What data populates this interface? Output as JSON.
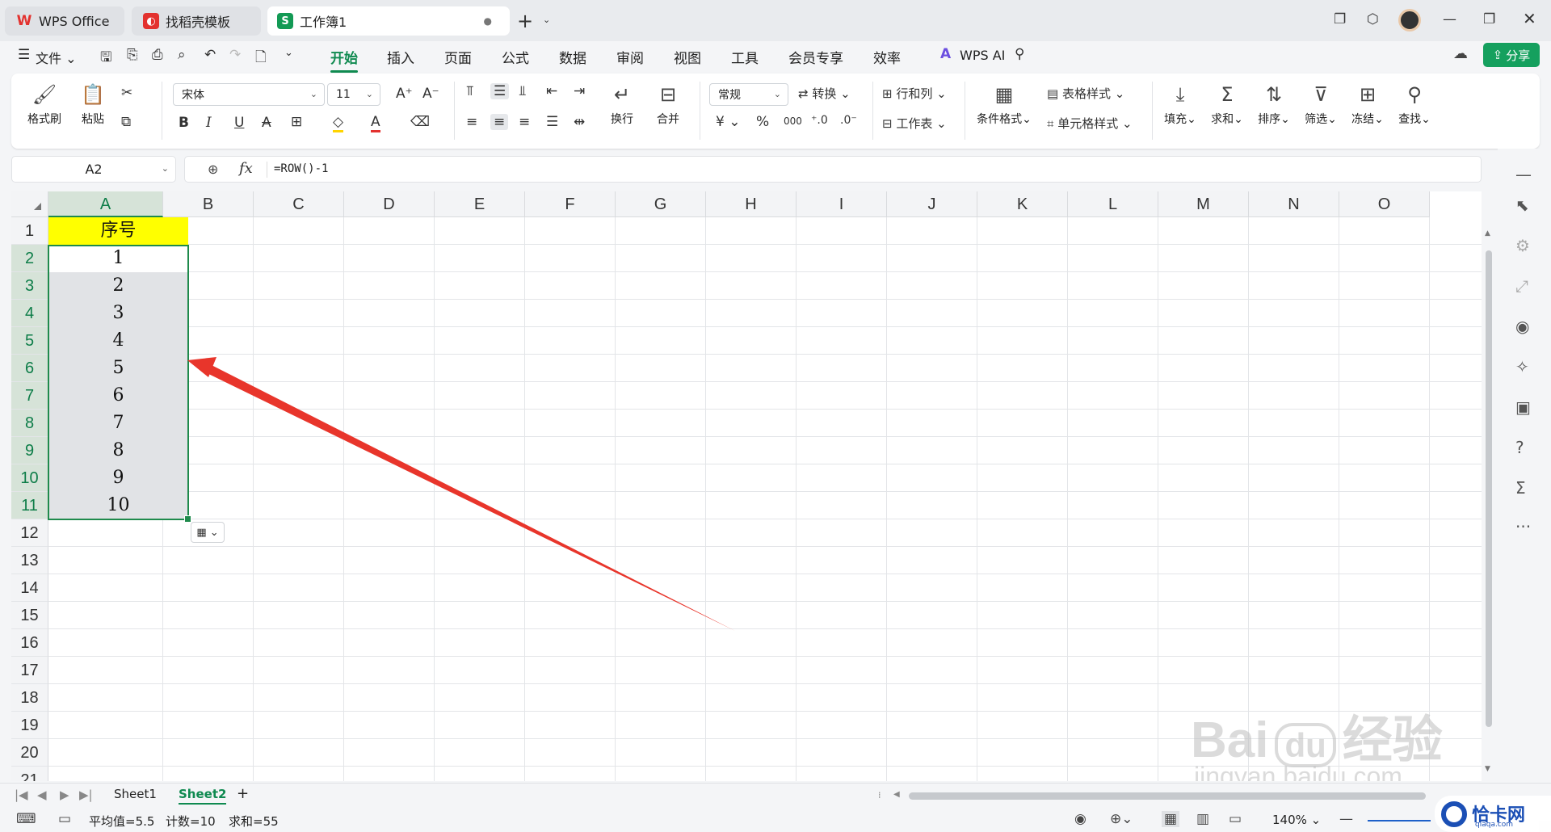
{
  "tabs": [
    {
      "label": "WPS Office"
    },
    {
      "label": "找稻壳模板"
    },
    {
      "label": "工作簿1"
    }
  ],
  "menubar": {
    "file": "文件",
    "items": [
      "开始",
      "插入",
      "页面",
      "公式",
      "数据",
      "审阅",
      "视图",
      "工具",
      "会员专享",
      "效率"
    ],
    "wps_ai": "WPS AI",
    "share": "分享"
  },
  "ribbon": {
    "format_painter": "格式刷",
    "paste": "粘贴",
    "font_name": "宋体",
    "font_size": "11",
    "wrap": "换行",
    "merge": "合并",
    "number_format": "常规",
    "convert": "转换",
    "rows_cols": "行和列",
    "worksheet": "工作表",
    "cond_format": "条件格式",
    "table_style": "表格样式",
    "cell_style": "单元格样式",
    "fill": "填充",
    "sum": "求和",
    "sort": "排序",
    "filter": "筛选",
    "freeze": "冻结",
    "find": "查找",
    "currency_symbol": "¥",
    "percent_symbol": "%",
    "thousands_symbol": "000"
  },
  "formula": {
    "name_box": "A2",
    "fx": "fx",
    "value": "=ROW()-1"
  },
  "grid": {
    "columns": [
      "A",
      "B",
      "C",
      "D",
      "E",
      "F",
      "G",
      "H",
      "I",
      "J",
      "K",
      "L",
      "M",
      "N",
      "O"
    ],
    "rows": [
      "1",
      "2",
      "3",
      "4",
      "5",
      "6",
      "7",
      "8",
      "9",
      "10",
      "11",
      "12",
      "13",
      "14",
      "15",
      "16",
      "17",
      "18",
      "19",
      "20",
      "21"
    ],
    "cells_a": [
      "序号",
      "1",
      "2",
      "3",
      "4",
      "5",
      "6",
      "7",
      "8",
      "9",
      "10"
    ],
    "header_fill": "#ffff00",
    "selection_color": "#1f8a4c",
    "arrow_color": "#e8352b"
  },
  "sheets": [
    "Sheet1",
    "Sheet2"
  ],
  "active_sheet": "Sheet2",
  "status": {
    "average": "平均值=5.5",
    "count": "计数=10",
    "sum": "求和=55",
    "zoom": "140%"
  },
  "watermarks": {
    "baidu": "Bai",
    "baidu_du": "du",
    "baidu_cn": "经验",
    "baidu_url": "jingyan.baidu.com",
    "site": "恰卡网",
    "site_url": "qiaqa.com"
  }
}
